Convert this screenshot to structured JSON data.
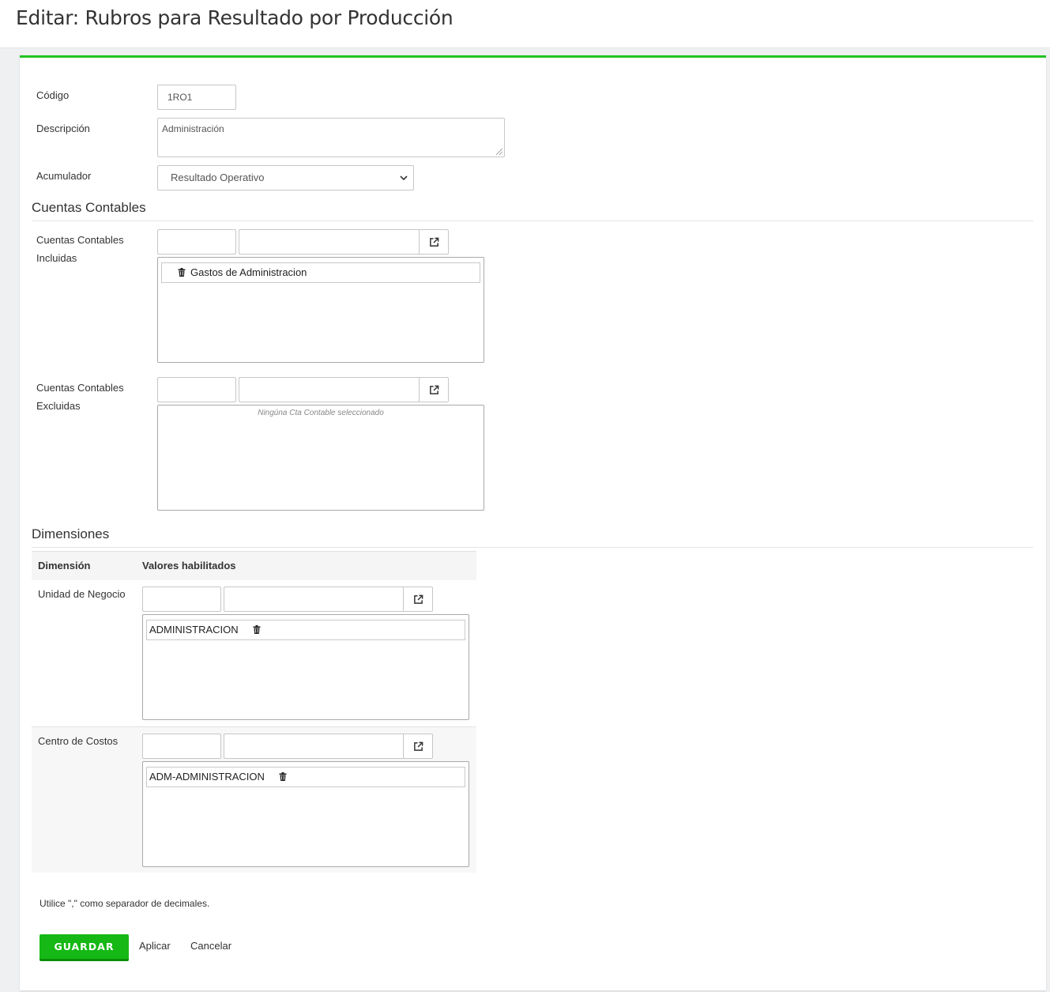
{
  "page": {
    "title": "Editar: Rubros para Resultado por Producción"
  },
  "colors": {
    "accent": "#22c322",
    "save_button": "#15b815"
  },
  "form": {
    "codigo": {
      "label": "Código",
      "value": "1RO1"
    },
    "descripcion": {
      "label": "Descripción",
      "value": "Administración"
    },
    "acumulador": {
      "label": "Acumulador",
      "selected": "Resultado Operativo"
    }
  },
  "cuentas": {
    "section_title": "Cuentas Contables",
    "incluidas": {
      "label_line1": "Cuentas Contables",
      "label_line2": "Incluidas",
      "items": [
        "Gastos de Administracion"
      ]
    },
    "excluidas": {
      "label_line1": "Cuentas Contables",
      "label_line2": "Excluidas",
      "empty_text": "Ningúna Cta Contable seleccionado"
    }
  },
  "dimensiones": {
    "section_title": "Dimensiones",
    "headers": {
      "dimension": "Dimensión",
      "valores": "Valores habilitados"
    },
    "rows": [
      {
        "name": "Unidad de Negocio",
        "items": [
          "ADMINISTRACION"
        ]
      },
      {
        "name": "Centro de Costos",
        "items": [
          "ADM-ADMINISTRACION"
        ]
      }
    ]
  },
  "footer": {
    "note": "Utilice \",\" como separador de decimales.",
    "save": "GUARDAR",
    "apply": "Aplicar",
    "cancel": "Cancelar"
  },
  "icons": {
    "lookup": "external-link-icon",
    "remove": "trash-icon",
    "select": "chevron-down-icon"
  }
}
